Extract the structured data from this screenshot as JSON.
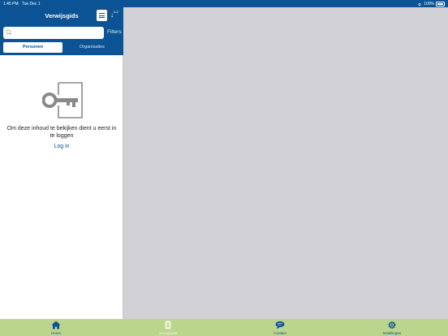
{
  "status_bar": {
    "time": "1:45 PM",
    "date": "Tue Dec 1",
    "battery": "100%"
  },
  "header": {
    "title": "Verwijsgids",
    "sort_label": "A Z"
  },
  "search": {
    "placeholder": "",
    "filters_label": "Filters"
  },
  "segments": [
    {
      "label": "Personen",
      "selected": true
    },
    {
      "label": "Organisaties",
      "selected": false
    }
  ],
  "empty_state": {
    "message": "Om deze inhoud te bekijken dient u eerst in te loggen",
    "link": "Log in"
  },
  "tabs": [
    {
      "label": "Home",
      "icon": "home-icon"
    },
    {
      "label": "Verwijsgids",
      "icon": "directory-icon"
    },
    {
      "label": "Contact",
      "icon": "chat-icon"
    },
    {
      "label": "Instellingen",
      "icon": "gear-icon"
    }
  ],
  "colors": {
    "primary": "#0b5394",
    "tab_bar": "#bcd58c",
    "detail_bg": "#d1d1d6"
  }
}
